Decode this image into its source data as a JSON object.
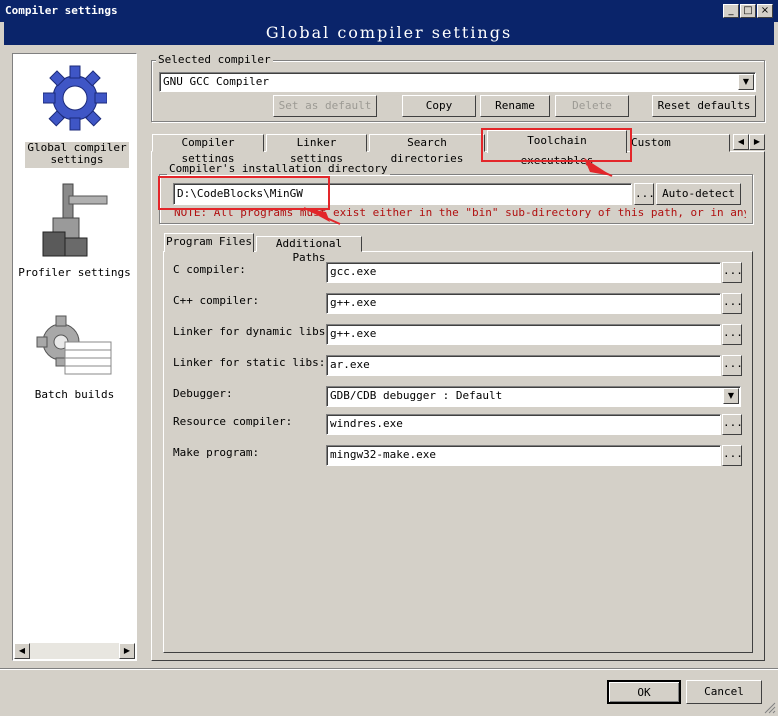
{
  "window": {
    "title": "Compiler settings",
    "header": "Global compiler settings",
    "minimize_glyph": "_",
    "maximize_glyph": "□",
    "close_glyph": "×"
  },
  "sidebar": {
    "items": [
      {
        "label": "Global compiler settings",
        "icon": "gear-icon"
      },
      {
        "label": "Profiler settings",
        "icon": "caliper-icon"
      },
      {
        "label": "Batch builds",
        "icon": "gear-stack-icon"
      }
    ],
    "scroll_left": "◀",
    "scroll_right": "▶"
  },
  "selected_compiler": {
    "label": "Selected compiler",
    "value": "GNU GCC Compiler",
    "dropdown_glyph": "▼",
    "buttons": {
      "set_default": "Set as default",
      "copy": "Copy",
      "rename": "Rename",
      "delete": "Delete",
      "reset_defaults": "Reset defaults"
    }
  },
  "tabs": {
    "compiler_settings": "Compiler settings",
    "linker_settings": "Linker settings",
    "search_directories": "Search directories",
    "toolchain_executables": "Toolchain executables",
    "custom_variables": "Custom variables",
    "scroll_left": "◀",
    "scroll_right": "▶"
  },
  "install_dir": {
    "label": "Compiler's installation directory",
    "value": "D:\\CodeBlocks\\MinGW",
    "browse": "...",
    "auto_detect": "Auto-detect",
    "note": "NOTE: All programs must exist either in the \"bin\" sub-directory of this path, or in any of the"
  },
  "sub_tabs": {
    "program_files": "Program Files",
    "additional_paths": "Additional Paths"
  },
  "programs": {
    "c_compiler": {
      "label": "C compiler:",
      "value": "gcc.exe"
    },
    "cpp_compiler": {
      "label": "C++ compiler:",
      "value": "g++.exe"
    },
    "linker_dynamic": {
      "label": "Linker for dynamic libs:",
      "value": "g++.exe"
    },
    "linker_static": {
      "label": "Linker for static libs:",
      "value": "ar.exe"
    },
    "debugger": {
      "label": "Debugger:",
      "value": "GDB/CDB debugger : Default"
    },
    "resource_compiler": {
      "label": "Resource compiler:",
      "value": "windres.exe"
    },
    "make_program": {
      "label": "Make program:",
      "value": "mingw32-make.exe"
    },
    "browse": "...",
    "dropdown_glyph": "▼"
  },
  "footer": {
    "ok": "OK",
    "cancel": "Cancel"
  },
  "colors": {
    "titlebar": "#0a246a",
    "face": "#d4d0c8",
    "highlight_box": "#e3262a",
    "note_text": "#b01010"
  }
}
